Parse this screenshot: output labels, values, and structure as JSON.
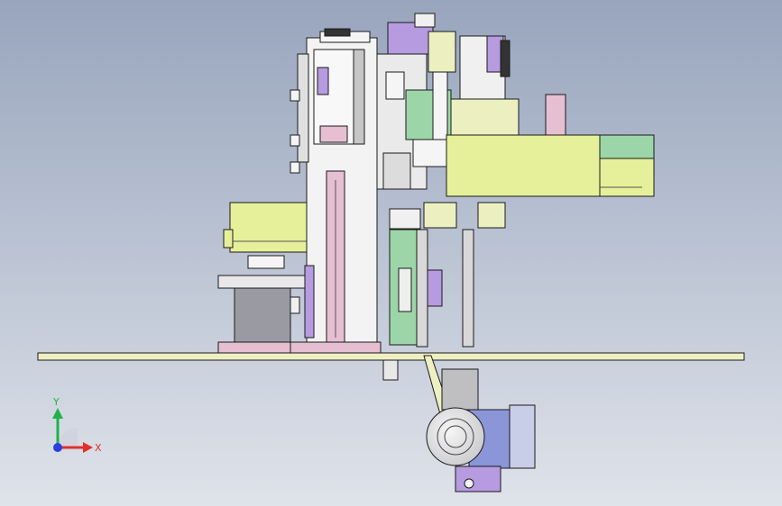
{
  "viewport": {
    "background_top": "#98a5bd",
    "background_bottom": "#dfe3ea"
  },
  "colors": {
    "plate": "#eef0c4",
    "frame": "#f3f3f3",
    "yellow_green": "#e6f09a",
    "mint": "#9cd6a8",
    "purple": "#b79be0",
    "pink": "#e6bfd2",
    "motor_blue": "#8a96d8",
    "gray": "#a6a6b0",
    "outline": "#1a1a1a"
  },
  "triad": {
    "y_label": "Y",
    "x_label": "X",
    "y_color": "#22b14c",
    "x_color": "#e0302a",
    "z_color": "#2a3fe0"
  }
}
